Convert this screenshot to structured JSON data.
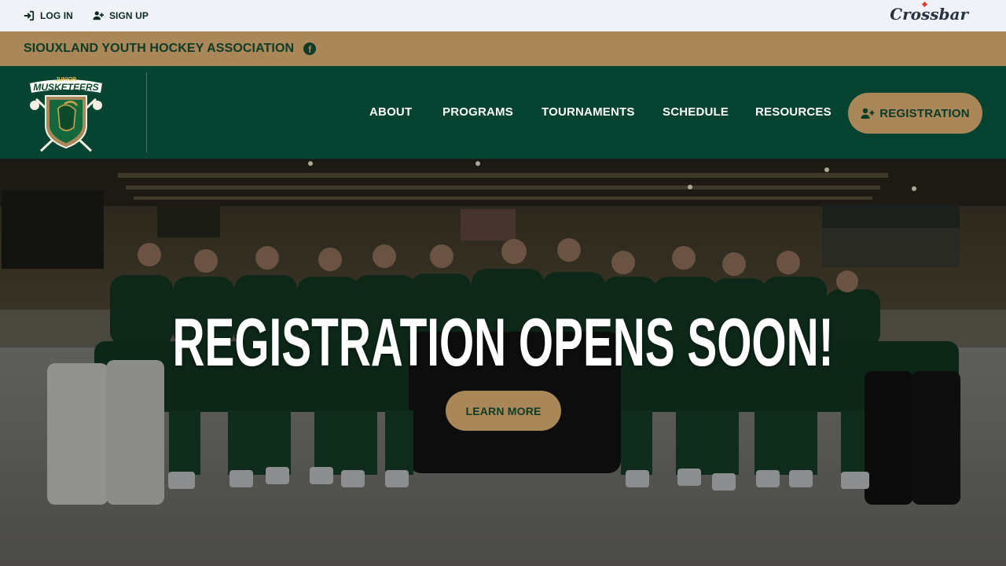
{
  "topbar": {
    "login_label": "LOG IN",
    "signup_label": "SIGN UP",
    "brand": "Crossbar"
  },
  "association": {
    "name": "SIOUXLAND YOUTH HOCKEY ASSOCIATION"
  },
  "logo": {
    "top_word": "JUNIOR",
    "main_word": "MUSKETEERS"
  },
  "nav": {
    "items": [
      {
        "label": "ABOUT"
      },
      {
        "label": "PROGRAMS"
      },
      {
        "label": "TOURNAMENTS"
      },
      {
        "label": "SCHEDULE"
      },
      {
        "label": "RESOURCES"
      }
    ],
    "registration_label": "REGISTRATION"
  },
  "hero": {
    "headline": "REGISTRATION OPENS SOON!",
    "cta_label": "LEARN MORE"
  },
  "colors": {
    "topbar_bg": "#eff3f7",
    "gold": "#a98759",
    "dark_green": "#064330",
    "text_dark_green": "#0c3b27"
  }
}
